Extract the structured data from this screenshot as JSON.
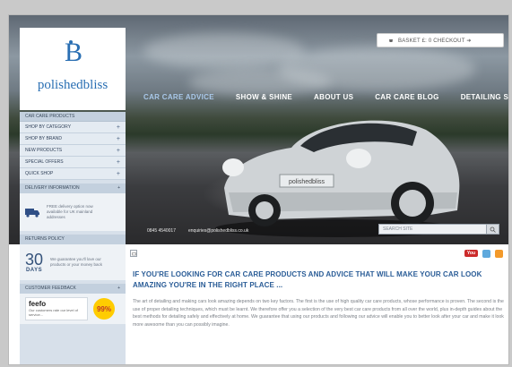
{
  "header": {
    "logo_text": "polishedbliss",
    "logo_mark": "B",
    "basket_text": "BASKET £: 0 CHECKOUT ➔"
  },
  "nav": {
    "items": [
      "CAR CARE ADVICE",
      "SHOW & SHINE",
      "ABOUT US",
      "CAR CARE BLOG",
      "DETAILING SERVICES"
    ]
  },
  "hero": {
    "plate": "polishedbliss",
    "phone": "0845 4540017",
    "email": "enquiries@polishedbliss.co.uk",
    "search_placeholder": "SEARCH SITE"
  },
  "sidebar": {
    "header": "CAR CARE PRODUCTS",
    "items": [
      {
        "label": "SHOP BY CATEGORY",
        "icon": "plus-icon"
      },
      {
        "label": "SHOP BY BRAND",
        "icon": "plus-icon"
      },
      {
        "label": "NEW PRODUCTS",
        "icon": "plus-icon"
      },
      {
        "label": "SPECIAL OFFERS",
        "icon": "plus-icon"
      },
      {
        "label": "QUICK SHOP",
        "icon": "plus-icon"
      }
    ],
    "delivery": {
      "title": "DELIVERY INFORMATION",
      "text": "FREE delivery option now available for UK mainland addresses"
    },
    "returns": {
      "title": "RETURNS POLICY",
      "days_num": "30",
      "days_label": "DAYS",
      "text": "We guarantee you'll love our products or your money back"
    },
    "feedback": {
      "title": "CUSTOMER FEEDBACK",
      "logo": "feefo",
      "text": "Our customers rate our level of service...",
      "score": "99%"
    }
  },
  "content": {
    "social": [
      "YouTube",
      "twitter",
      "rss"
    ],
    "youtube_label": "You",
    "headline": "IF YOU'RE LOOKING FOR CAR CARE PRODUCTS AND ADVICE THAT WILL MAKE YOUR CAR LOOK AMAZING YOU'RE IN THE RIGHT PLACE ...",
    "body": "The art of detailing and making cars look amazing depends on two key factors. The first is the use of high quality car care products, whose performance is proven. The second is the use of proper detailing techniques, which must be learnt. We therefore offer you a selection of the very best car care products from all over the world, plus in-depth guides about the best methods for detailing safely and effectively at home. We guarantee that using our products and following our advice will enable you to better look after your car and make it look more awesome than you can possibly imagine."
  },
  "colors": {
    "brand_blue": "#2b5d97",
    "sidebar_bg": "#d7e0ea",
    "feefo_yellow": "#ffcc00"
  }
}
